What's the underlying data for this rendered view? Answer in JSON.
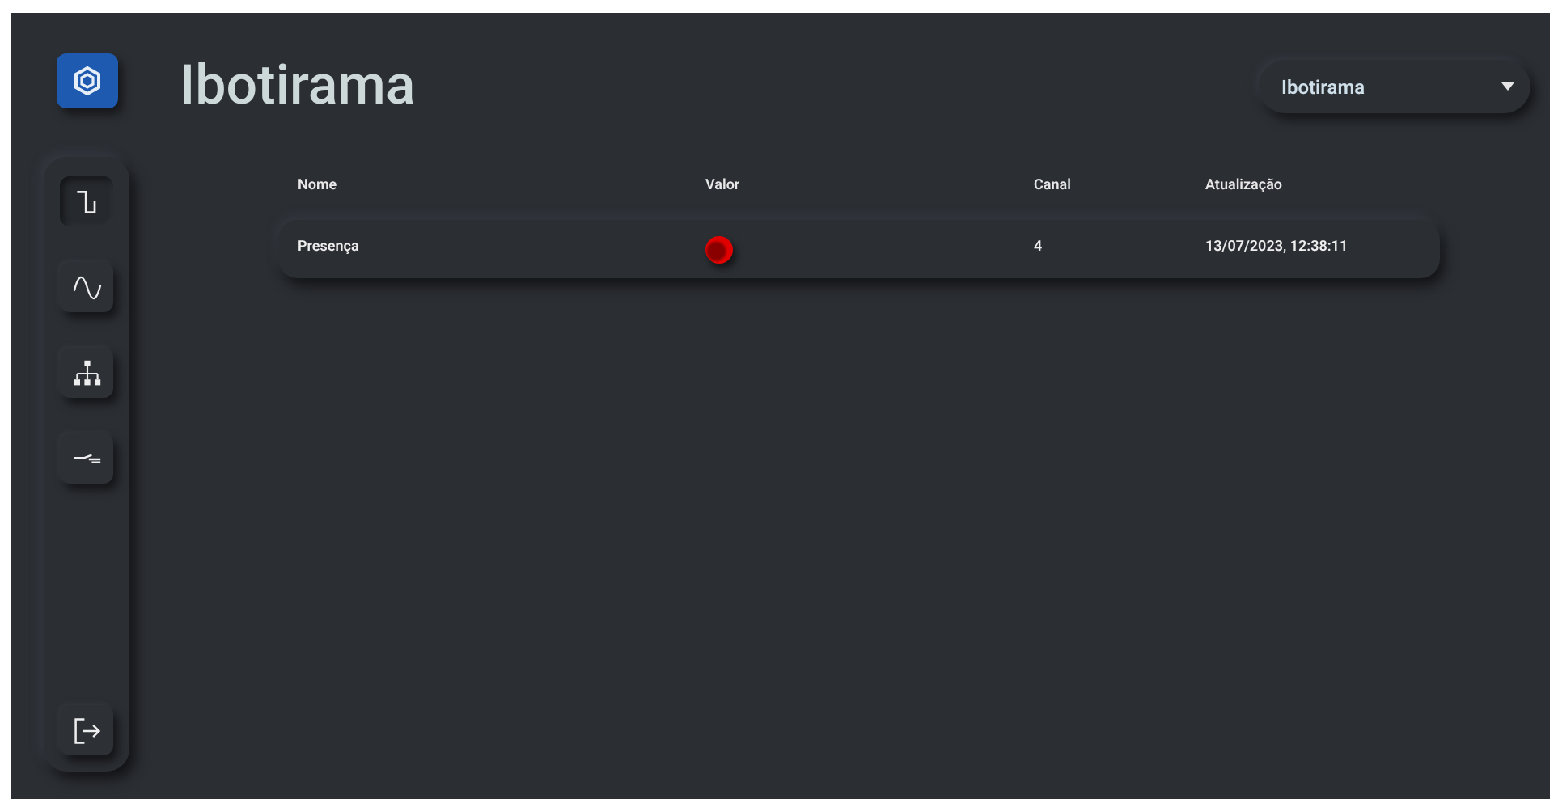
{
  "header": {
    "title": "Ibotirama",
    "location_select": {
      "value": "Ibotirama"
    }
  },
  "sidebar": {
    "items": [
      {
        "kind": "digital",
        "selected": true
      },
      {
        "kind": "analog",
        "selected": false
      },
      {
        "kind": "network",
        "selected": false
      },
      {
        "kind": "switch",
        "selected": false
      }
    ],
    "logout": {
      "kind": "logout"
    }
  },
  "table": {
    "columns": [
      "Nome",
      "Valor",
      "Canal",
      "Atualização"
    ],
    "rows": [
      {
        "nome": "Presença",
        "valor_on": false,
        "canal": "4",
        "atualizacao": "13/07/2023, 12:38:11"
      }
    ]
  }
}
